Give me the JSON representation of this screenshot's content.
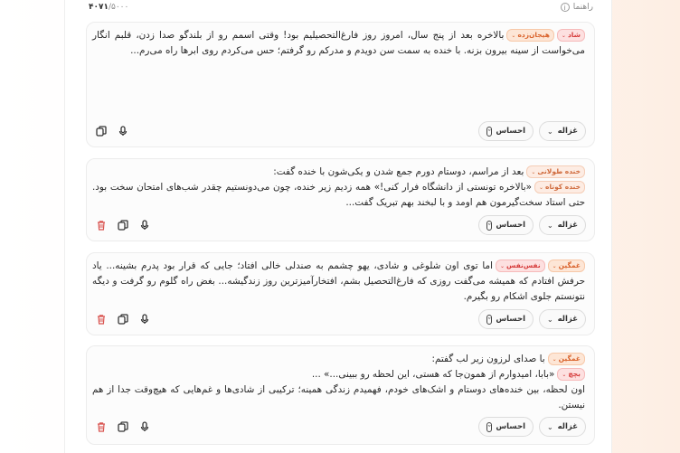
{
  "header": {
    "guide_label": "راهنما",
    "info_icon": "i",
    "counter_current": "۴۰۷۱",
    "counter_max": "/۵۰۰۰"
  },
  "icons": {
    "copy": "copy-icon",
    "mic": "microphone-icon",
    "delete": "trash-icon",
    "emotion": "emotion-icon",
    "chevron": "chevron-down-icon"
  },
  "colors": {
    "tag_orange": "#d9622b",
    "tag_red": "#d63b3b",
    "delete_red": "#d9534f"
  },
  "controls": {
    "emotion_label": "احساس",
    "voice_label": "غزاله"
  },
  "blocks": [
    {
      "segments": [
        {
          "tags": [
            "شاد",
            "هیجان‌زده"
          ],
          "text": "بالاخره بعد از پنج سال، امروز روز فارغ‌التحصیلیم بود! وقتی اسمم رو از بلندگو صدا زدن، قلبم انگار می‌خواست از سینه بیرون بزنه. با خنده به سمت سن دویدم و مدرکم رو گرفتم؛ حس می‌کردم روی ابرها راه می‌رم..."
        }
      ]
    },
    {
      "segments": [
        {
          "tags": [
            "خنده طولانی"
          ],
          "text": "بعد از مراسم، دوستام دورم جمع شدن و یکی‌شون با خنده گفت:"
        },
        {
          "tags": [
            "خنده کوتاه"
          ],
          "text": "«بالاخره تونستی از دانشگاه فرار کنی!» همه زدیم زیر خنده، چون می‌دونستیم چقدر شب‌های امتحان سخت بود. حتی استاد سخت‌گیرمون هم اومد و با لبخند بهم تبریک گفت..."
        }
      ]
    },
    {
      "segments": [
        {
          "tags": [
            "غمگین",
            "نفس‌نفس"
          ],
          "text": "اما توی اون شلوغی و شادی، یهو چشمم به صندلی خالی افتاد؛ جایی که قرار بود پدرم بشینه... یاد حرفش افتادم که همیشه می‌گفت روزی که فارغ‌التحصیل بشم، افتخارآمیزترین روز زندگیشه... بغض راه گلوم رو گرفت و دیگه نتونستم جلوی اشکام رو بگیرم."
        }
      ]
    },
    {
      "segments": [
        {
          "tags": [
            "غمگین"
          ],
          "text": "با صدای لرزون زیر لب گفتم:"
        },
        {
          "tags": [
            "بچچ"
          ],
          "text": "«بابا، امیدوارم از همون‌جا که هستی، این لحظه رو ببینی...» ..."
        },
        {
          "tags": [],
          "text": "اون لحظه، بین خنده‌های دوستام و اشک‌های خودم، فهمیدم زندگی همینه؛ ترکیبی از شادی‌ها و غم‌هایی که هیچ‌وقت جدا از هم نیستن."
        }
      ]
    }
  ]
}
